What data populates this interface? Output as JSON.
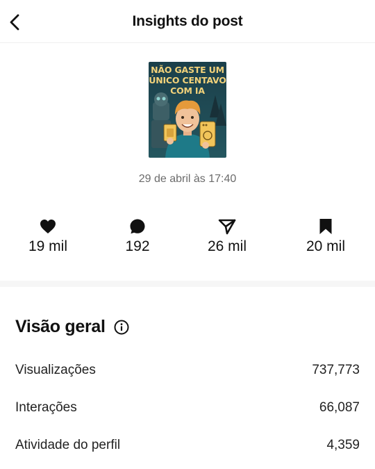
{
  "header": {
    "title": "Insights do post",
    "back_icon": "chevron-left-icon"
  },
  "post": {
    "thumbnail_text": [
      "NÃO GASTE UM",
      "ÚNICO CENTAVO",
      "COM IA"
    ],
    "date": "29 de abril às 17:40"
  },
  "stats": [
    {
      "icon": "heart-icon",
      "value": "19 mil"
    },
    {
      "icon": "comment-icon",
      "value": "192"
    },
    {
      "icon": "share-icon",
      "value": "26 mil"
    },
    {
      "icon": "bookmark-icon",
      "value": "20 mil"
    }
  ],
  "overview": {
    "title": "Visão geral",
    "info_icon": "info-icon",
    "rows": [
      {
        "label": "Visualizações",
        "value": "737,773"
      },
      {
        "label": "Interações",
        "value": "66,087"
      },
      {
        "label": "Atividade do perfil",
        "value": "4,359"
      }
    ]
  },
  "colors": {
    "text": "#111111",
    "muted": "#6b6b6b",
    "divider": "#f6f6f6",
    "thumb_bg": "#1d4650",
    "thumb_text": "#f2d27a"
  }
}
